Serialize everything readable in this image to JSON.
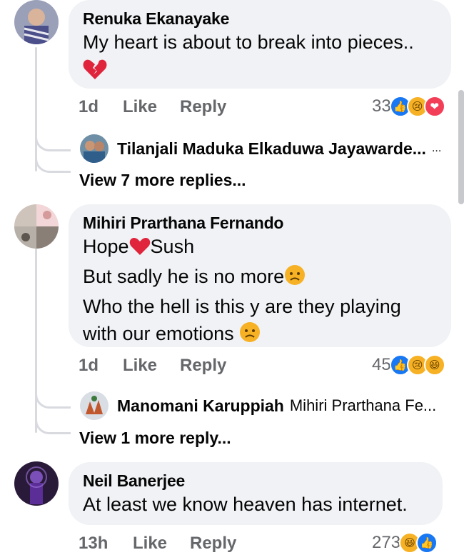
{
  "comments": [
    {
      "author": "Renuka Ekanayake",
      "lines": [
        "My heart is about to break into pieces.."
      ],
      "time": "1d",
      "like_label": "Like",
      "reply_label": "Reply",
      "reaction_count": "33",
      "reactions": [
        "like-icon",
        "sad-icon",
        "love-icon"
      ],
      "replies": [
        {
          "name": "Tilanjali Maduka Elkaduwa Jayawarde...",
          "text": "..."
        }
      ],
      "view_more": "View 7 more replies..."
    },
    {
      "author": "Mihiri Prarthana Fernando",
      "lines": [
        "Hope",
        "Sush",
        "But sadly he is no more",
        "Who the hell is this y are they playing",
        "with our emotions"
      ],
      "time": "1d",
      "like_label": "Like",
      "reply_label": "Reply",
      "reaction_count": "45",
      "reactions": [
        "like-icon",
        "sad-icon",
        "haha-icon"
      ],
      "replies": [
        {
          "name": "Manomani Karuppiah",
          "text": "Mihiri Prarthana Fe..."
        }
      ],
      "view_more": "View 1 more reply..."
    },
    {
      "author": "Neil Banerjee",
      "lines": [
        "At least we know heaven has internet."
      ],
      "time": "13h",
      "like_label": "Like",
      "reply_label": "Reply",
      "reaction_count": "273",
      "reactions": [
        "haha-icon",
        "like-icon"
      ]
    }
  ],
  "colors": {
    "bubble": "#f0f2f5",
    "meta": "#65676b",
    "like": "#1877f2",
    "love": "#f33e58",
    "sad": "#f7b125"
  }
}
